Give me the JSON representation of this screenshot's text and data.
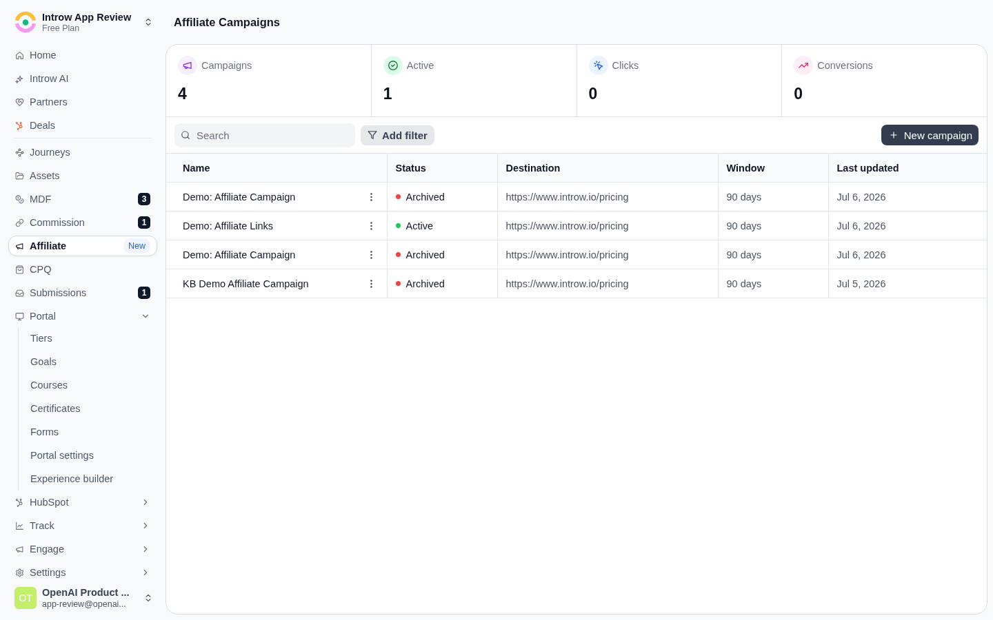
{
  "sidebar": {
    "workspace": {
      "name": "Introw App Review",
      "plan": "Free Plan"
    },
    "sections": [
      {
        "items": [
          {
            "kind": "link",
            "label": "Home",
            "selected": false
          },
          {
            "kind": "link",
            "label": "Introw AI",
            "selected": false
          },
          {
            "kind": "link",
            "label": "Partners",
            "selected": false
          },
          {
            "kind": "link",
            "label": "Deals",
            "selected": false
          }
        ]
      },
      {
        "items": [
          {
            "kind": "link",
            "label": "Journeys",
            "selected": false
          },
          {
            "kind": "link",
            "label": "Assets",
            "selected": false
          },
          {
            "kind": "link",
            "label": "MDF",
            "selected": false,
            "badge": {
              "kind": "count",
              "text": "3"
            }
          },
          {
            "kind": "link",
            "label": "Commission",
            "selected": false,
            "badge": {
              "kind": "count",
              "text": "1"
            }
          },
          {
            "kind": "link",
            "label": "Affiliate",
            "selected": true,
            "badge": {
              "kind": "tag",
              "text": "New"
            }
          },
          {
            "kind": "link",
            "label": "CPQ",
            "selected": false
          },
          {
            "kind": "link",
            "label": "Submissions",
            "selected": false,
            "badge": {
              "kind": "count",
              "text": "1"
            }
          },
          {
            "kind": "group",
            "label": "Portal",
            "selected": false,
            "expanded": true,
            "children": [
              {
                "label": "Tiers",
                "selected": false
              },
              {
                "label": "Goals",
                "selected": false
              },
              {
                "label": "Courses",
                "selected": false
              },
              {
                "label": "Certificates",
                "selected": false
              },
              {
                "label": "Forms",
                "selected": false
              },
              {
                "label": "Portal settings",
                "selected": false
              },
              {
                "label": "Experience builder",
                "selected": false
              }
            ]
          },
          {
            "kind": "group",
            "label": "HubSpot",
            "selected": false,
            "expanded": false
          },
          {
            "kind": "group",
            "label": "Track",
            "selected": false,
            "expanded": false
          },
          {
            "kind": "group",
            "label": "Engage",
            "selected": false,
            "expanded": false
          },
          {
            "kind": "group",
            "label": "Settings",
            "selected": false,
            "expanded": false
          }
        ]
      }
    ],
    "user": {
      "initials": "OT",
      "name": "OpenAI Product ...",
      "email": "app-review@openai..."
    }
  },
  "page": {
    "title": "Affiliate Campaigns"
  },
  "stats": [
    {
      "label": "Campaigns",
      "value": "4"
    },
    {
      "label": "Active",
      "value": "1"
    },
    {
      "label": "Clicks",
      "value": "0"
    },
    {
      "label": "Conversions",
      "value": "0"
    }
  ],
  "toolbar": {
    "search": {
      "placeholder": "Search"
    },
    "filter_button": "Add filter",
    "new_button": "New campaign"
  },
  "table": {
    "columns": [
      "Name",
      "Status",
      "Destination",
      "Window",
      "Last updated"
    ],
    "rows": [
      {
        "name": "Demo: Affiliate Campaign",
        "status": {
          "label": "Archived",
          "color": "#ef4444"
        },
        "destination": "https://www.introw.io/pricing",
        "window": "90 days",
        "last_updated": "Jul 6, 2026"
      },
      {
        "name": "Demo: Affiliate Links",
        "status": {
          "label": "Active",
          "color": "#22c55e"
        },
        "destination": "https://www.introw.io/pricing",
        "window": "90 days",
        "last_updated": "Jul 6, 2026"
      },
      {
        "name": "Demo: Affiliate Campaign",
        "status": {
          "label": "Archived",
          "color": "#ef4444"
        },
        "destination": "https://www.introw.io/pricing",
        "window": "90 days",
        "last_updated": "Jul 6, 2026"
      },
      {
        "name": "KB Demo Affiliate Campaign",
        "status": {
          "label": "Archived",
          "color": "#ef4444"
        },
        "destination": "https://www.introw.io/pricing",
        "window": "90 days",
        "last_updated": "Jul 5, 2026"
      }
    ]
  }
}
